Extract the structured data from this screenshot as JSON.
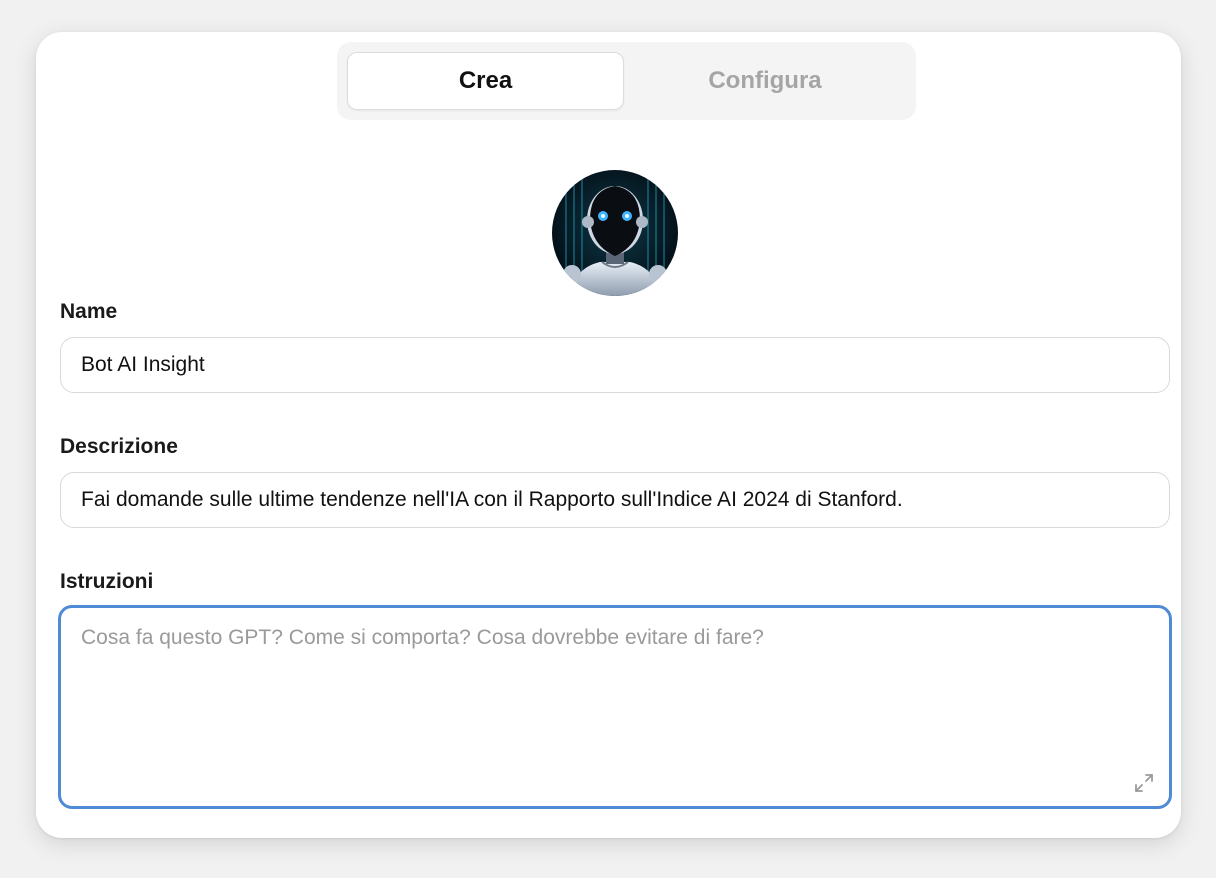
{
  "tabs": [
    {
      "label": "Crea",
      "active": true
    },
    {
      "label": "Configura",
      "active": false
    }
  ],
  "avatar": {
    "icon": "robot-avatar-icon"
  },
  "fields": {
    "name": {
      "label": "Name",
      "value": "Bot AI Insight"
    },
    "description": {
      "label": "Descrizione",
      "value": "Fai domande sulle ultime tendenze nell'IA con il Rapporto sull'Indice AI 2024 di Stanford."
    },
    "instructions": {
      "label": "Istruzioni",
      "value": "",
      "placeholder": "Cosa fa questo GPT? Come si comporta? Cosa dovrebbe evitare di fare?"
    }
  },
  "colors": {
    "focus_border": "#4f8ad6",
    "placeholder": "#9a9a9a",
    "inactive_tab": "#a5a5a5"
  }
}
